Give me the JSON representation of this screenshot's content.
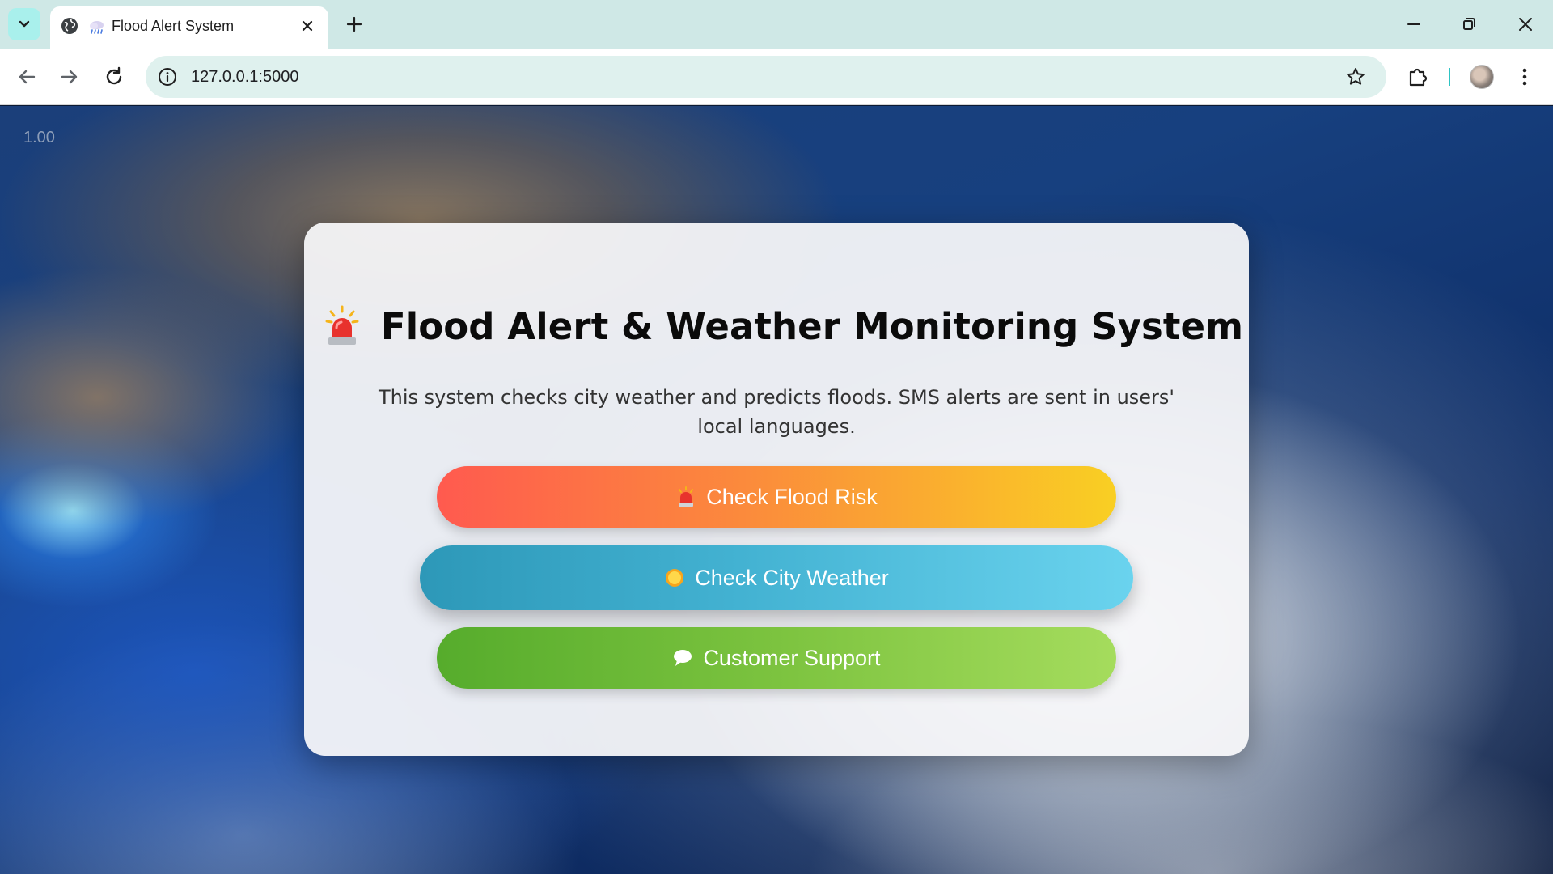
{
  "browser": {
    "tab_title": "Flood Alert System",
    "url": "127.0.0.1:5000"
  },
  "page": {
    "zoom_badge": "1.00",
    "title": "Flood Alert & Weather Monitoring System",
    "description": "This system checks city weather and predicts floods. SMS alerts are sent in users' local languages.",
    "buttons": [
      {
        "label": "Check Flood Risk",
        "icon": "siren-icon"
      },
      {
        "label": "Check City Weather",
        "icon": "sun-icon"
      },
      {
        "label": "Customer Support",
        "icon": "speech-bubble-icon"
      }
    ]
  },
  "colors": {
    "flood_gradient": [
      "#ff5a4f",
      "#f9cf23"
    ],
    "weather_gradient": [
      "#2d98b8",
      "#6ad3ee"
    ],
    "support_gradient": [
      "#56ac2c",
      "#a5dc5d"
    ],
    "tabstrip": "#cfe8e6",
    "omnibox": "#dff1ee"
  }
}
